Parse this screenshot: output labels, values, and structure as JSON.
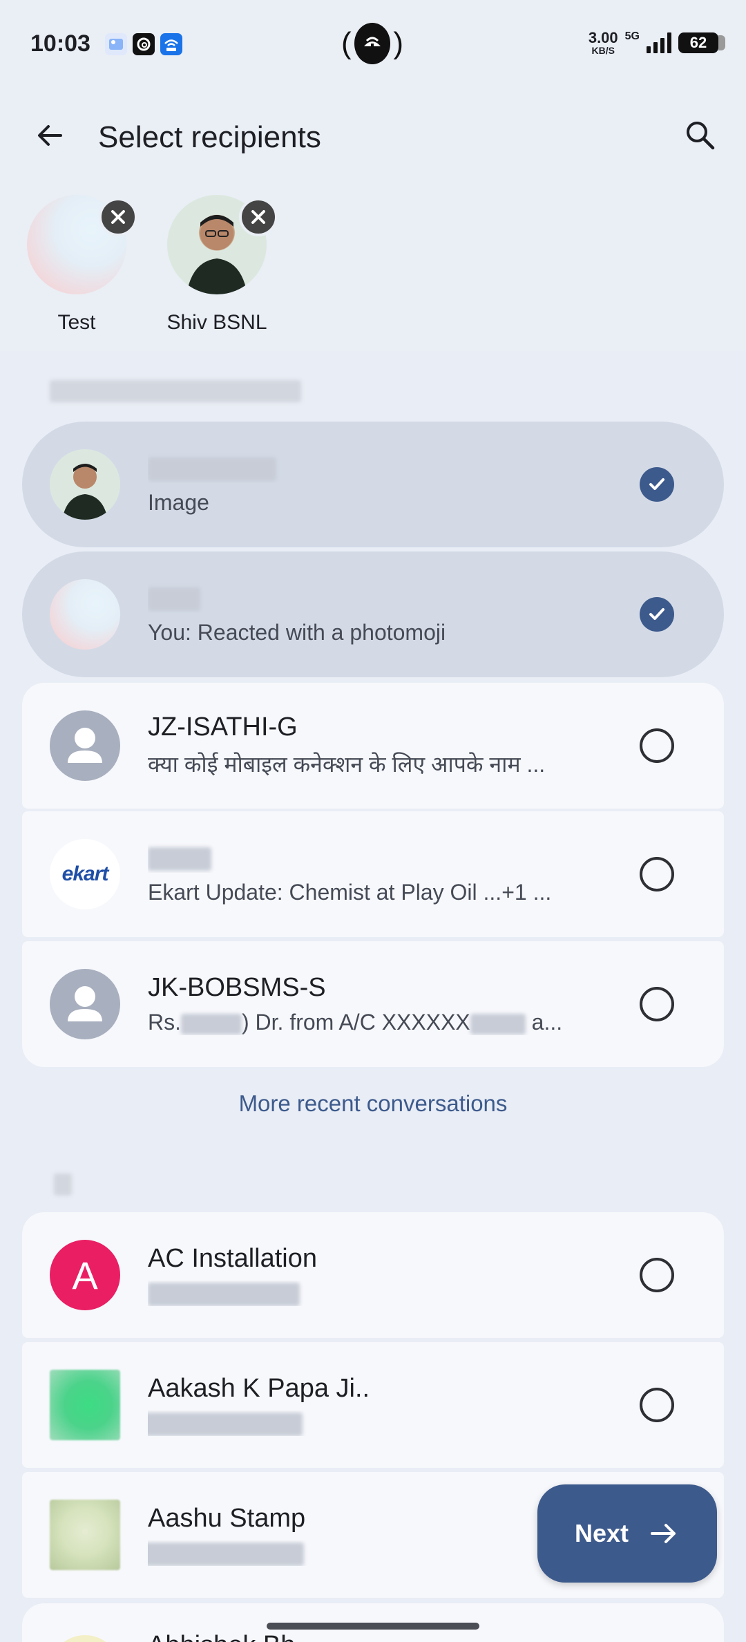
{
  "status_bar": {
    "time": "10:03",
    "speed_value": "3.00",
    "speed_unit": "KB/S",
    "network": "5G",
    "battery": "62"
  },
  "header": {
    "title": "Select recipients",
    "back_icon": "arrow-back-icon",
    "search_icon": "search-icon"
  },
  "selected": [
    {
      "name": "Test"
    },
    {
      "name": "Shiv BSNL"
    }
  ],
  "recent": {
    "items": [
      {
        "title": "",
        "subtitle": "Image",
        "checked": true
      },
      {
        "title": "",
        "subtitle": "You: Reacted with a photomoji",
        "checked": true
      },
      {
        "title": "JZ-ISATHI-G",
        "subtitle": "क्या कोई मोबाइल कनेक्शन के लिए आपके नाम ...",
        "checked": false
      },
      {
        "title": "",
        "subtitle": "Ekart Update: Chemist at Play Oil ...+1 ...",
        "checked": false,
        "logo_text": "ekart"
      },
      {
        "title": "JK-BOBSMS-S",
        "subtitle_parts": [
          "Rs.",
          ") Dr. from A/C XXXXXX",
          " a..."
        ],
        "checked": false
      }
    ],
    "more_label": "More recent conversations"
  },
  "contacts": {
    "section_letter": "A",
    "items": [
      {
        "title": "AC Installation",
        "avatar_letter": "A",
        "avatar_color": "#e91e63",
        "checked": false
      },
      {
        "title": "Aakash K Papa Ji..",
        "checked": false
      },
      {
        "title": "Aashu Stamp",
        "checked": false
      },
      {
        "title": "Abhishek Bh..."
      }
    ]
  },
  "fab": {
    "label": "Next",
    "icon": "arrow-forward-icon"
  },
  "colors": {
    "accent": "#3d5a8c",
    "selected_row": "#d3dae6",
    "row_bg": "#f7f8fc",
    "page_bg": "#eaeef5"
  }
}
